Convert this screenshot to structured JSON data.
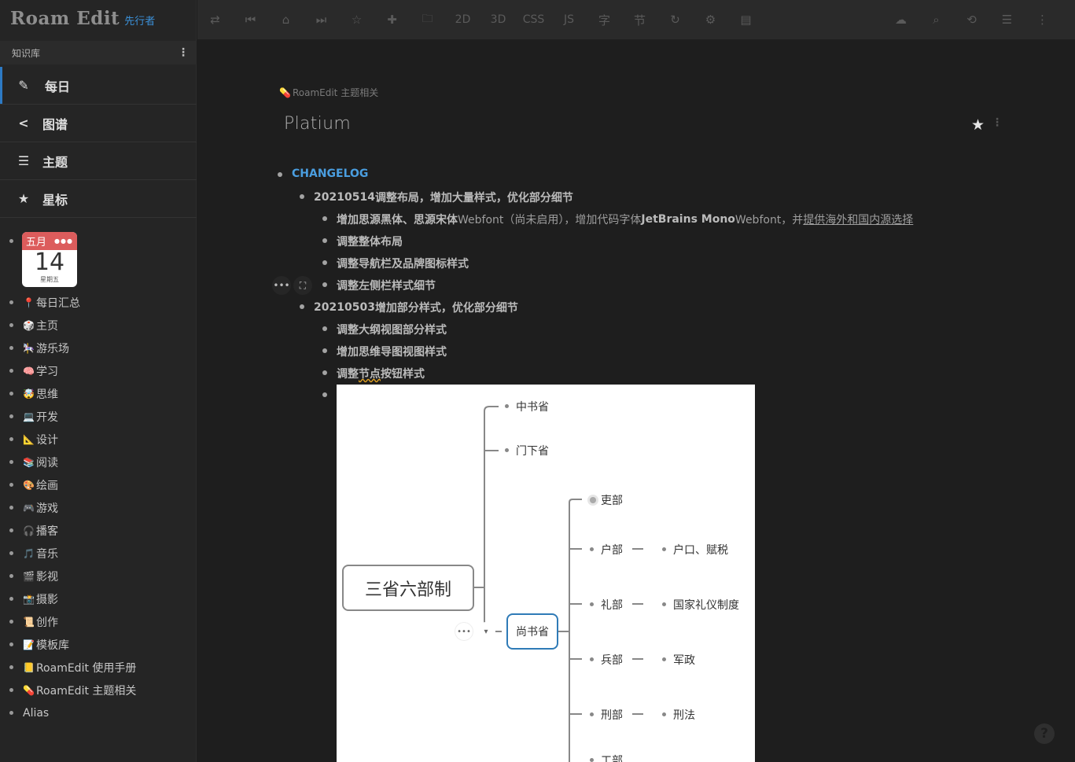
{
  "app": {
    "name": "Roam Edit",
    "badge": "先行者"
  },
  "sidebar": {
    "kb_label": "知识库",
    "nav": [
      {
        "label": "每日",
        "icon": "edit-icon"
      },
      {
        "label": "图谱",
        "icon": "share-icon"
      },
      {
        "label": "主题",
        "icon": "list-icon"
      },
      {
        "label": "星标",
        "icon": "star-icon"
      }
    ],
    "calendar": {
      "month": "五月",
      "day": "14",
      "weekday": "星期五"
    },
    "tree": [
      {
        "emoji": "📍",
        "label": "每日汇总"
      },
      {
        "emoji": "🎲",
        "label": "主页"
      },
      {
        "emoji": "🎠",
        "label": "游乐场"
      },
      {
        "emoji": "🧠",
        "label": "学习"
      },
      {
        "emoji": "🤯",
        "label": "思维"
      },
      {
        "emoji": "💻",
        "label": "开发"
      },
      {
        "emoji": "📐",
        "label": "设计"
      },
      {
        "emoji": "📚",
        "label": "阅读"
      },
      {
        "emoji": "🎨",
        "label": "绘画"
      },
      {
        "emoji": "🎮",
        "label": "游戏"
      },
      {
        "emoji": "🎧",
        "label": "播客"
      },
      {
        "emoji": "🎵",
        "label": "音乐"
      },
      {
        "emoji": "🎬",
        "label": "影视"
      },
      {
        "emoji": "📸",
        "label": "摄影"
      },
      {
        "emoji": "📜",
        "label": "创作"
      },
      {
        "emoji": "📝",
        "label": "模板库"
      },
      {
        "emoji": "📒",
        "label": "RoamEdit 使用手册"
      },
      {
        "emoji": "💊",
        "label": "RoamEdit 主题相关"
      },
      {
        "emoji": "",
        "label": "Alias"
      }
    ]
  },
  "toolbar": {
    "left": [
      {
        "name": "swap-icon",
        "glyph": "⇄"
      },
      {
        "name": "skip-back-icon",
        "glyph": "⏮"
      },
      {
        "name": "inbox-icon",
        "glyph": "⌂"
      },
      {
        "name": "skip-forward-icon",
        "glyph": "⏭"
      },
      {
        "name": "star-outline-icon",
        "glyph": "☆"
      },
      {
        "name": "plus-icon",
        "glyph": "✚"
      },
      {
        "name": "folder-icon",
        "glyph": "🗀"
      },
      {
        "name": "2d-button",
        "glyph": "2D"
      },
      {
        "name": "3d-button",
        "glyph": "3D"
      },
      {
        "name": "css-button",
        "glyph": "CSS"
      },
      {
        "name": "js-button",
        "glyph": "JS"
      },
      {
        "name": "font-button",
        "glyph": "字"
      },
      {
        "name": "section-button",
        "glyph": "节"
      },
      {
        "name": "refresh-icon",
        "glyph": "↻"
      },
      {
        "name": "gear-icon",
        "glyph": "⚙"
      },
      {
        "name": "comment-icon",
        "glyph": "▤"
      }
    ],
    "right": [
      {
        "name": "cloud-icon",
        "glyph": "☁"
      },
      {
        "name": "search-icon",
        "glyph": "⌕"
      },
      {
        "name": "history-icon",
        "glyph": "⟲"
      },
      {
        "name": "outline-icon",
        "glyph": "☰"
      },
      {
        "name": "more-icon",
        "glyph": "⋮"
      }
    ]
  },
  "page": {
    "breadcrumb": "RoamEdit 主题相关",
    "title": "Platium",
    "blocks": {
      "changelog": "CHANGELOG",
      "v1_date": "20210514",
      "v1_text": " 调整布局，增加大量样式，优化部分细节",
      "v1_i1_a": "增加思源黑体、思源宋体",
      "v1_i1_b": " Webfont（尚未启用），增加代码字体",
      "v1_i1_c": "JetBrains Mono",
      "v1_i1_d": " Webfont，并",
      "v1_i1_e": "提供海外和国内源选择",
      "v1_i2": "调整整体布局",
      "v1_i3": "调整导航栏及品牌图标样式",
      "v1_i4": "调整左侧栏样式细节",
      "v2_date": "20210503",
      "v2_text": " 增加部分样式，优化部分细节",
      "v2_i1": "调整大纲视图部分样式",
      "v2_i2": "增加思维导图视图样式",
      "v2_i3_a": "调整",
      "v2_i3_b": "节点",
      "v2_i3_c": "按钮样式"
    }
  },
  "mindmap": {
    "root": "三省六部制",
    "branches": [
      "中书省",
      "门下省",
      "尚书省"
    ],
    "ministries": [
      "吏部",
      "户部",
      "礼部",
      "兵部",
      "刑部",
      "工部"
    ],
    "duties": [
      "户口、赋税",
      "国家礼仪制度",
      "军政",
      "刑法"
    ]
  }
}
